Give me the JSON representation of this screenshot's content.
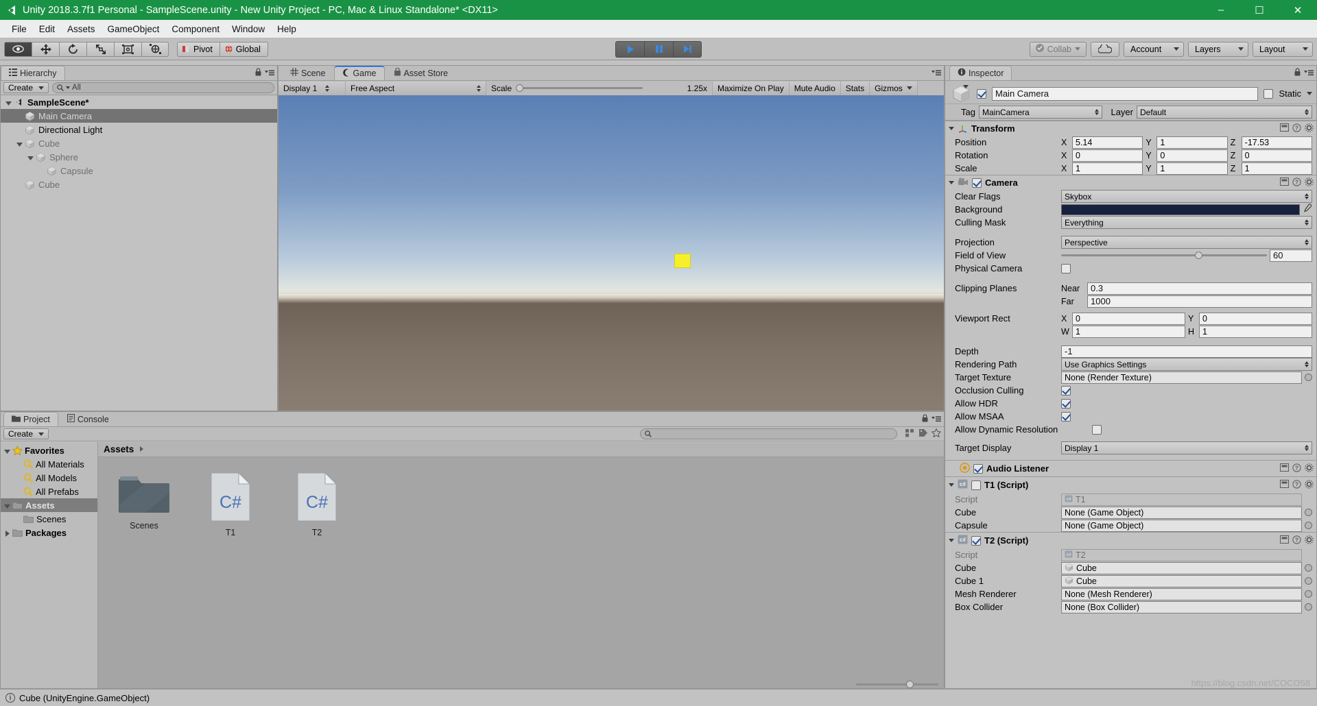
{
  "window": {
    "title": "Unity 2018.3.7f1 Personal - SampleScene.unity - New Unity Project - PC, Mac & Linux Standalone* <DX11>",
    "minimize": "–",
    "maximize": "☐",
    "close": "✕"
  },
  "menubar": {
    "items": [
      "File",
      "Edit",
      "Assets",
      "GameObject",
      "Component",
      "Window",
      "Help"
    ]
  },
  "toolbar": {
    "tools": [
      "hand-tool",
      "move-tool",
      "rotate-tool",
      "scale-tool",
      "rect-tool",
      "transform-tool"
    ],
    "pivot_label": "Pivot",
    "global_label": "Global",
    "play_label": "play-button",
    "pause_label": "pause-button",
    "step_label": "step-button",
    "collab_label": "Collab",
    "cloud_label": "cloud-button",
    "account_label": "Account",
    "layers_label": "Layers",
    "layout_label": "Layout"
  },
  "hierarchy": {
    "tab_label": "Hierarchy",
    "create_label": "Create",
    "search_placeholder": "All",
    "items": [
      {
        "label": "SampleScene*",
        "depth": 0,
        "type": "scene",
        "expanded": true,
        "selected": false
      },
      {
        "label": "Main Camera",
        "depth": 1,
        "type": "object",
        "expanded": null,
        "selected": true
      },
      {
        "label": "Directional Light",
        "depth": 1,
        "type": "object",
        "expanded": null,
        "selected": false
      },
      {
        "label": "Cube",
        "depth": 1,
        "type": "object",
        "expanded": true,
        "selected": false
      },
      {
        "label": "Sphere",
        "depth": 2,
        "type": "object",
        "expanded": true,
        "selected": false
      },
      {
        "label": "Capsule",
        "depth": 3,
        "type": "object",
        "expanded": null,
        "selected": false
      },
      {
        "label": "Cube",
        "depth": 1,
        "type": "object",
        "expanded": null,
        "selected": false
      }
    ]
  },
  "gameview": {
    "tabs": [
      {
        "label": "Scene",
        "icon": "grid-icon",
        "active": false
      },
      {
        "label": "Game",
        "icon": "gamepad-icon",
        "active": true
      },
      {
        "label": "Asset Store",
        "icon": "store-icon",
        "active": false
      }
    ],
    "display": "Display 1",
    "aspect": "Free Aspect",
    "scale_label": "Scale",
    "scale_value": "1.25x",
    "maximize_label": "Maximize On Play",
    "mute_label": "Mute Audio",
    "stats_label": "Stats",
    "gizmos_label": "Gizmos"
  },
  "project": {
    "tabs": [
      {
        "label": "Project",
        "icon": "folder-icon",
        "active": true
      },
      {
        "label": "Console",
        "icon": "console-icon",
        "active": false
      }
    ],
    "create_label": "Create",
    "search_placeholder": "",
    "tree": [
      {
        "label": "Favorites",
        "type": "favorites",
        "depth": 0,
        "expanded": true,
        "selected": false,
        "bold": true
      },
      {
        "label": "All Materials",
        "type": "search",
        "depth": 1,
        "expanded": null,
        "selected": false,
        "bold": false
      },
      {
        "label": "All Models",
        "type": "search",
        "depth": 1,
        "expanded": null,
        "selected": false,
        "bold": false
      },
      {
        "label": "All Prefabs",
        "type": "search",
        "depth": 1,
        "expanded": null,
        "selected": false,
        "bold": false
      },
      {
        "label": "Assets",
        "type": "folder",
        "depth": 0,
        "expanded": true,
        "selected": true,
        "bold": true
      },
      {
        "label": "Scenes",
        "type": "folder",
        "depth": 1,
        "expanded": null,
        "selected": false,
        "bold": false
      },
      {
        "label": "Packages",
        "type": "folder",
        "depth": 0,
        "expanded": false,
        "selected": false,
        "bold": true
      }
    ],
    "breadcrumb": "Assets",
    "assets": [
      {
        "label": "Scenes",
        "type": "folder"
      },
      {
        "label": "T1",
        "type": "csharp"
      },
      {
        "label": "T2",
        "type": "csharp"
      }
    ]
  },
  "inspector": {
    "tab_label": "Inspector",
    "object_name": "Main Camera",
    "object_enabled": true,
    "static_label": "Static",
    "tag_label": "Tag",
    "tag_value": "MainCamera",
    "layer_label": "Layer",
    "layer_value": "Default",
    "transform": {
      "title": "Transform",
      "rows": [
        {
          "label": "Position",
          "x": "5.14",
          "y": "1",
          "z": "-17.53"
        },
        {
          "label": "Rotation",
          "x": "0",
          "y": "0",
          "z": "0"
        },
        {
          "label": "Scale",
          "x": "1",
          "y": "1",
          "z": "1"
        }
      ]
    },
    "camera": {
      "title": "Camera",
      "enabled": true,
      "clear_flags_label": "Clear Flags",
      "clear_flags_value": "Skybox",
      "background_label": "Background",
      "background_color": "#17223f",
      "culling_label": "Culling Mask",
      "culling_value": "Everything",
      "projection_label": "Projection",
      "projection_value": "Perspective",
      "fov_label": "Field of View",
      "fov_value": "60",
      "physical_label": "Physical Camera",
      "physical_checked": false,
      "clipping_label": "Clipping Planes",
      "near_label": "Near",
      "near_value": "0.3",
      "far_label": "Far",
      "far_value": "1000",
      "viewport_label": "Viewport Rect",
      "viewport_x": "0",
      "viewport_y": "0",
      "viewport_w": "1",
      "viewport_h": "1",
      "depth_label": "Depth",
      "depth_value": "-1",
      "rendering_label": "Rendering Path",
      "rendering_value": "Use Graphics Settings",
      "target_texture_label": "Target Texture",
      "target_texture_value": "None (Render Texture)",
      "occlusion_label": "Occlusion Culling",
      "occlusion_checked": true,
      "hdr_label": "Allow HDR",
      "hdr_checked": true,
      "msaa_label": "Allow MSAA",
      "msaa_checked": true,
      "dynres_label": "Allow Dynamic Resolution",
      "dynres_checked": false,
      "target_display_label": "Target Display",
      "target_display_value": "Display 1"
    },
    "audio_listener": {
      "title": "Audio Listener",
      "enabled": true
    },
    "t1": {
      "title": "T1 (Script)",
      "enabled": false,
      "rows": [
        {
          "label": "Script",
          "value": "T1",
          "kind": "script"
        },
        {
          "label": "Cube",
          "value": "None (Game Object)",
          "kind": "object"
        },
        {
          "label": "Capsule",
          "value": "None (Game Object)",
          "kind": "object"
        }
      ]
    },
    "t2": {
      "title": "T2 (Script)",
      "enabled": true,
      "rows": [
        {
          "label": "Script",
          "value": "T2",
          "kind": "script"
        },
        {
          "label": "Cube",
          "value": "Cube",
          "kind": "gameobject"
        },
        {
          "label": "Cube 1",
          "value": "Cube",
          "kind": "gameobject"
        },
        {
          "label": "Mesh Renderer",
          "value": "None (Mesh Renderer)",
          "kind": "object"
        },
        {
          "label": "Box Collider",
          "value": "None (Box Collider)",
          "kind": "object"
        }
      ]
    }
  },
  "statusbar": {
    "text": "Cube (UnityEngine.GameObject)"
  },
  "watermark": {
    "text": "https://blog.csdn.net/COCO58"
  },
  "colors": {
    "title_green": "#1a9245",
    "panel_gray": "#c2c2c2",
    "selection_gray": "#737373",
    "play_blue": "#3a8ade",
    "csharp_blue": "#4a6fb5"
  }
}
